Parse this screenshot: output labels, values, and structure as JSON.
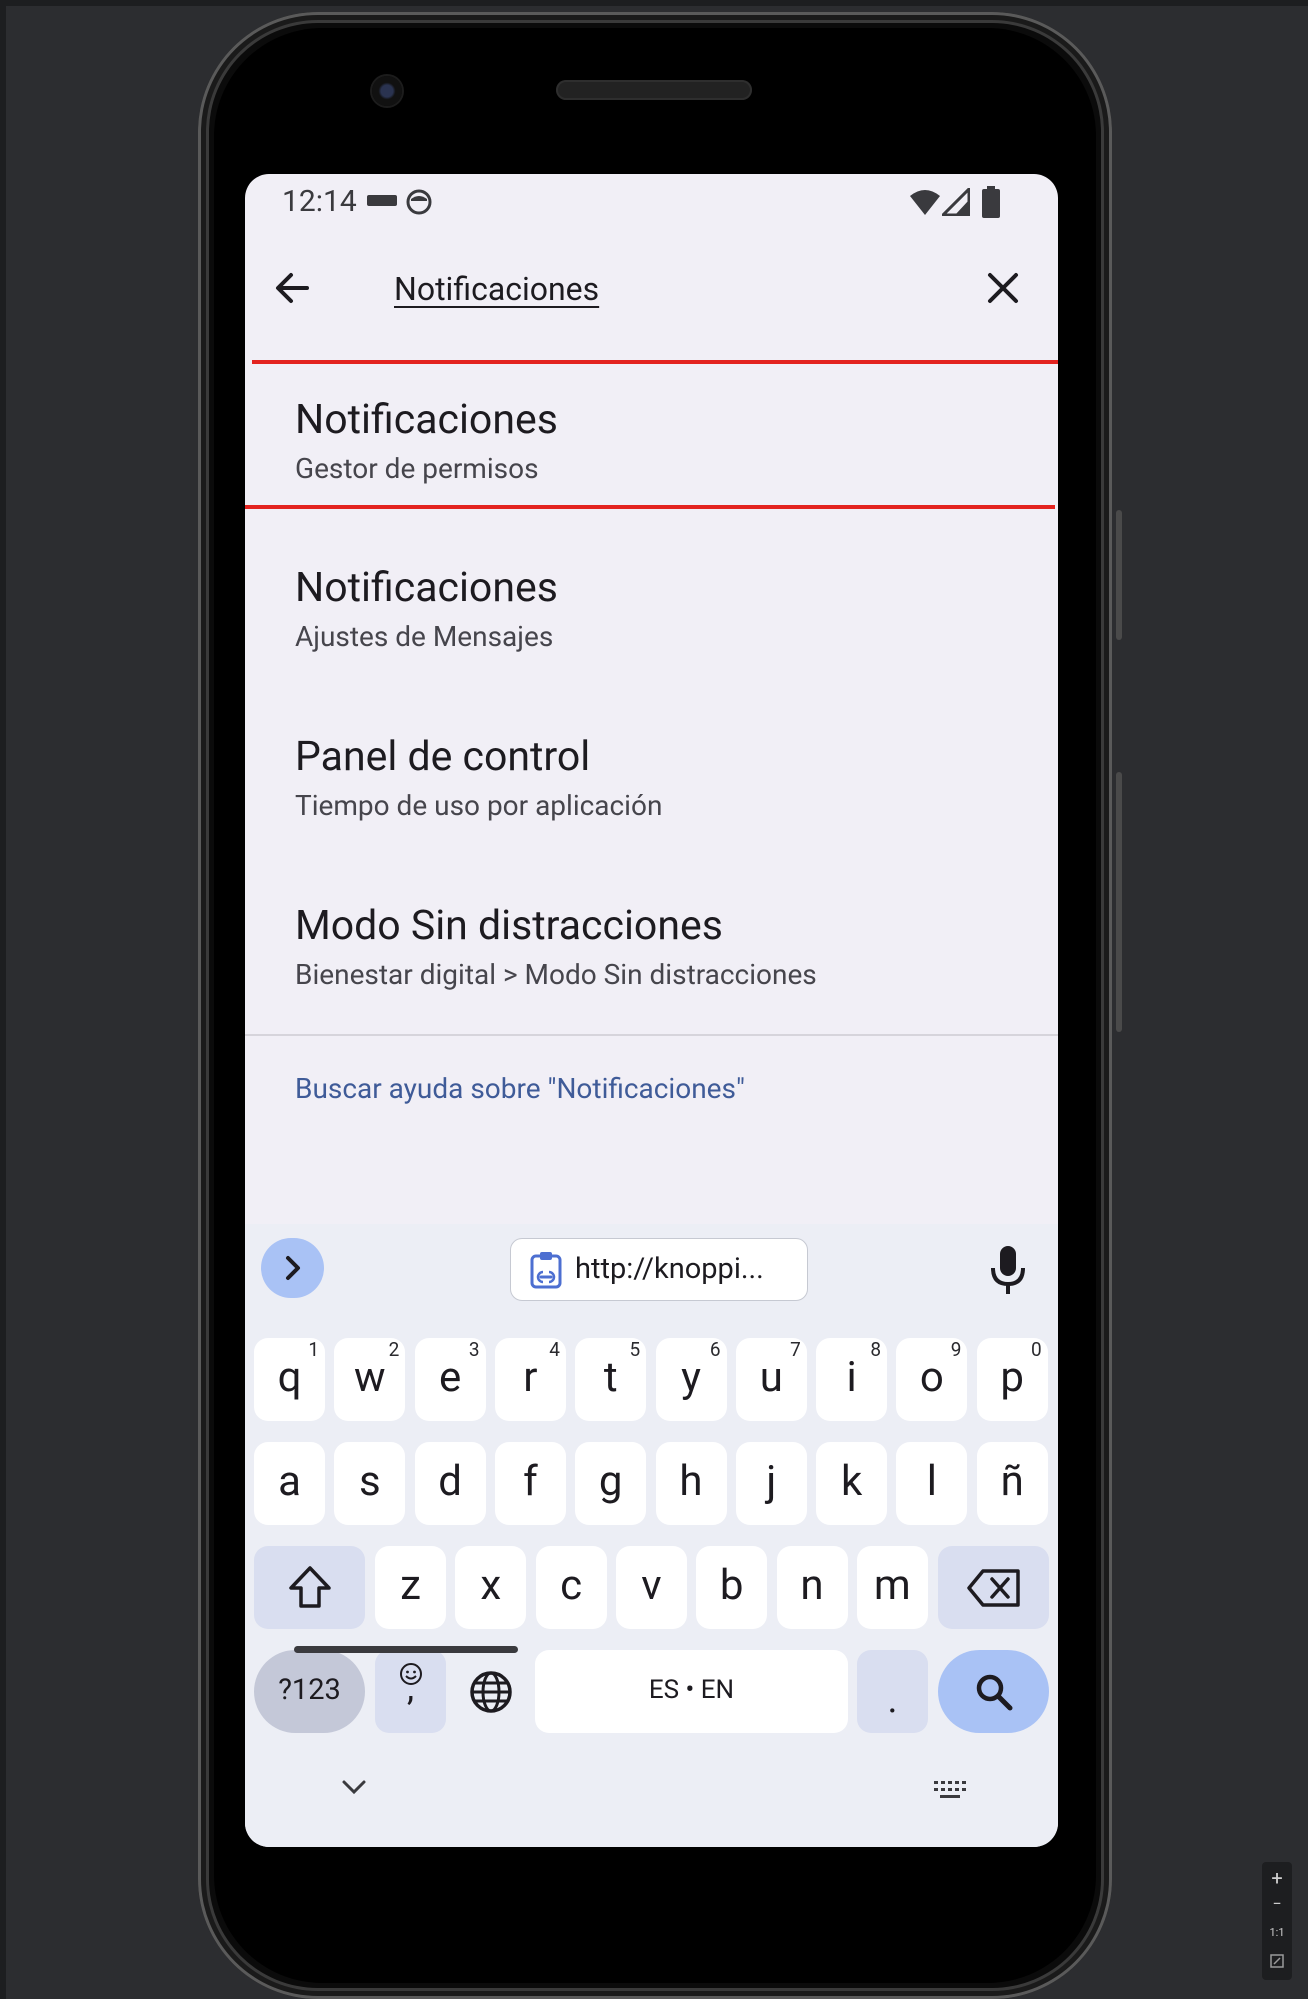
{
  "status_bar": {
    "time": "12:14"
  },
  "search": {
    "query": "Notificaciones"
  },
  "results": [
    {
      "title": "Notificaciones",
      "subtitle": "Gestor de permisos"
    },
    {
      "title": "Notificaciones",
      "subtitle": "Ajustes de Mensajes"
    },
    {
      "title": "Panel de control",
      "subtitle": "Tiempo de uso por aplicación"
    },
    {
      "title": "Modo Sin distracciones",
      "subtitle": "Bienestar digital > Modo Sin distracciones"
    }
  ],
  "help_link": "Buscar ayuda sobre \"Notificaciones\"",
  "keyboard": {
    "clipboard_suggestion": "http://knoppi...",
    "row1": [
      {
        "k": "q",
        "n": "1"
      },
      {
        "k": "w",
        "n": "2"
      },
      {
        "k": "e",
        "n": "3"
      },
      {
        "k": "r",
        "n": "4"
      },
      {
        "k": "t",
        "n": "5"
      },
      {
        "k": "y",
        "n": "6"
      },
      {
        "k": "u",
        "n": "7"
      },
      {
        "k": "i",
        "n": "8"
      },
      {
        "k": "o",
        "n": "9"
      },
      {
        "k": "p",
        "n": "0"
      }
    ],
    "row2": [
      "a",
      "s",
      "d",
      "f",
      "g",
      "h",
      "j",
      "k",
      "l",
      "ñ"
    ],
    "row3": [
      "z",
      "x",
      "c",
      "v",
      "b",
      "n",
      "m"
    ],
    "symbols_key": "?123",
    "emoji_comma_key": ",",
    "space_label": "ES • EN",
    "period_key": "."
  },
  "zoom_controls": {
    "plus": "+",
    "minus": "−",
    "one_to_one": "1:1"
  },
  "colors": {
    "accent_red": "#e32320",
    "help_link": "#3f5b98",
    "key_blue": "#a9c2f5"
  }
}
